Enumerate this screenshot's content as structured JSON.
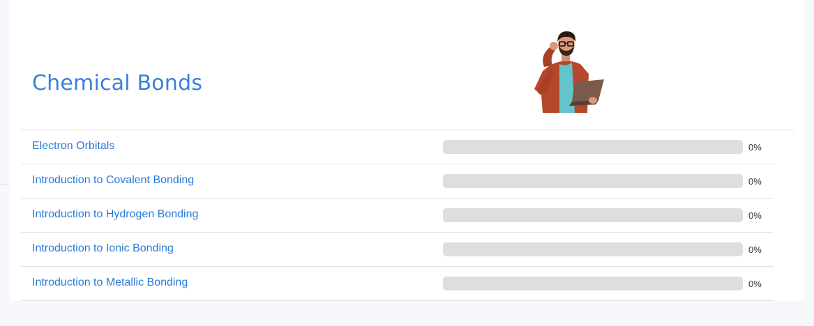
{
  "header": {
    "title": "Chemical Bonds",
    "illustration_icon": "person-with-laptop-illustration"
  },
  "lessons": [
    {
      "title": "Electron Orbitals",
      "progress": 0,
      "progress_label": "0%"
    },
    {
      "title": "Introduction to Covalent Bonding",
      "progress": 0,
      "progress_label": "0%"
    },
    {
      "title": "Introduction to Hydrogen Bonding",
      "progress": 0,
      "progress_label": "0%"
    },
    {
      "title": "Introduction to Ionic Bonding",
      "progress": 0,
      "progress_label": "0%"
    },
    {
      "title": "Introduction to Metallic Bonding",
      "progress": 0,
      "progress_label": "0%"
    }
  ],
  "colors": {
    "title": "#3a80d9",
    "link": "#2a7ad6",
    "progress_track": "#dedede",
    "page_background": "#f7f8fc"
  }
}
